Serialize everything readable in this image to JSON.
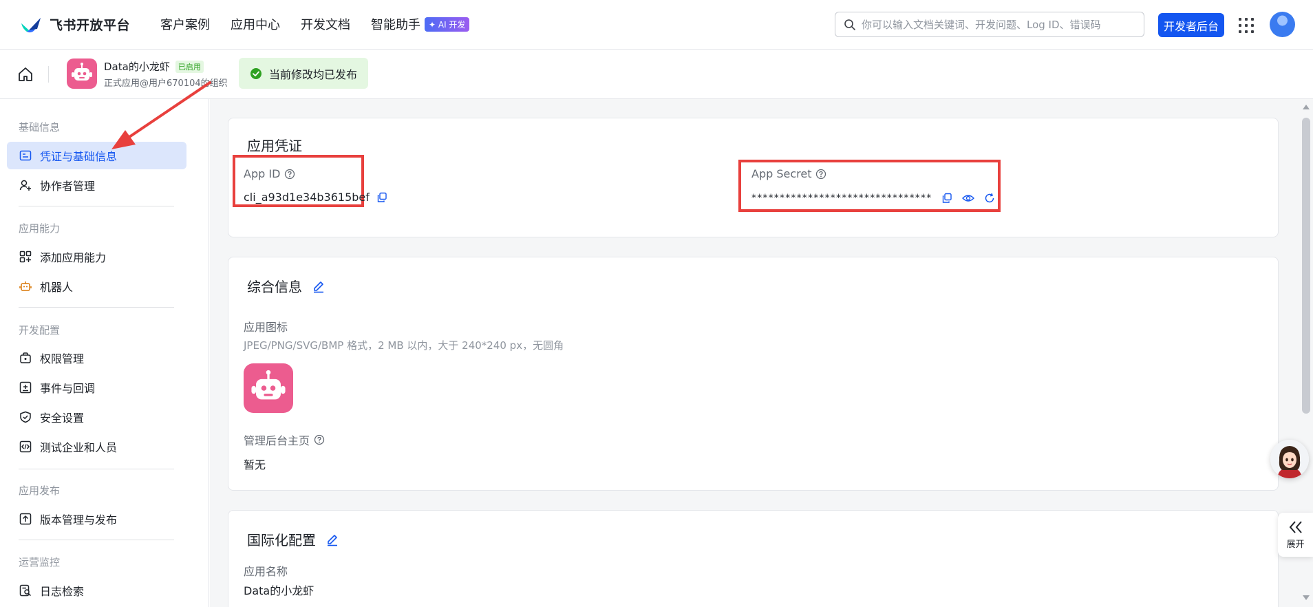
{
  "topnav": {
    "brand": "飞书开放平台",
    "items": [
      {
        "label": "客户案例"
      },
      {
        "label": "应用中心"
      },
      {
        "label": "开发文档"
      },
      {
        "label": "智能助手",
        "badge": "✦ AI 开发"
      }
    ],
    "search_placeholder": "你可以输入文档关键词、开发问题、Log ID、错误码",
    "dev_console": "开发者后台"
  },
  "appbar": {
    "app_name": "Data的小龙虾",
    "status": "已启用",
    "subtitle": "正式应用@用户670104的组织",
    "published": "当前修改均已发布"
  },
  "sidebar": {
    "groups": [
      {
        "title": "基础信息",
        "items": [
          {
            "label": "凭证与基础信息",
            "icon": "id-card-icon",
            "active": true
          },
          {
            "label": "协作者管理",
            "icon": "user-add-icon"
          }
        ]
      },
      {
        "title": "应用能力",
        "items": [
          {
            "label": "添加应用能力",
            "icon": "apps-add-icon"
          },
          {
            "label": "机器人",
            "icon": "robot-icon"
          }
        ]
      },
      {
        "title": "开发配置",
        "items": [
          {
            "label": "权限管理",
            "icon": "lock-bag-icon"
          },
          {
            "label": "事件与回调",
            "icon": "event-icon"
          },
          {
            "label": "安全设置",
            "icon": "shield-check-icon"
          },
          {
            "label": "测试企业和人员",
            "icon": "code-icon"
          }
        ]
      },
      {
        "title": "应用发布",
        "items": [
          {
            "label": "版本管理与发布",
            "icon": "upload-icon"
          }
        ]
      },
      {
        "title": "运营监控",
        "items": [
          {
            "label": "日志检索",
            "icon": "log-search-icon"
          }
        ]
      }
    ]
  },
  "credentials": {
    "title": "应用凭证",
    "app_id_label": "App ID",
    "app_id": "cli_a93d1e34b3615bef",
    "app_secret_label": "App Secret",
    "app_secret": "********************************"
  },
  "general": {
    "title": "综合信息",
    "icon_label": "应用图标",
    "icon_hint": "JPEG/PNG/SVG/BMP 格式，2 MB 以内，大于 240*240 px，无圆角",
    "admin_home_label": "管理后台主页",
    "admin_home_value": "暂无"
  },
  "i18n": {
    "title": "国际化配置",
    "name_label": "应用名称",
    "name_value": "Data的小龙虾"
  },
  "floating": {
    "expand_label": "展开"
  },
  "colors": {
    "primary": "#1456f0",
    "active_bg": "#dce6fc",
    "success_bg": "#e4f7e1",
    "success": "#2ea121",
    "annotation_red": "#e8403d",
    "app_pink": "#ec5c8f"
  }
}
